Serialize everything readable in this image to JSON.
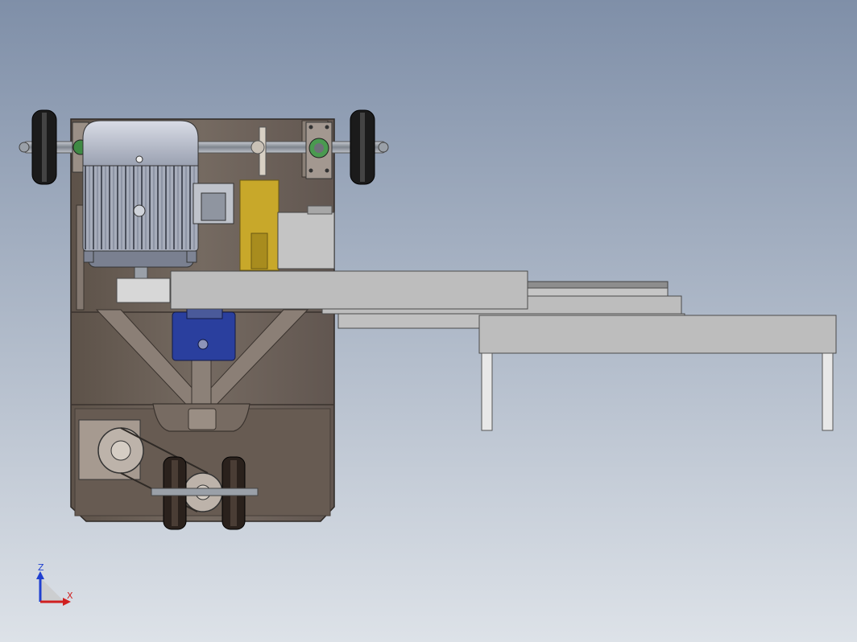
{
  "view": {
    "background_top": "#7f8fa8",
    "background_bottom": "#dde2e8"
  },
  "colors": {
    "frame": "#6e6258",
    "frame_dark": "#3f3833",
    "frame_light": "#9d928a",
    "motor_body": "#b6bcc9",
    "motor_fins": "#8f96a6",
    "motor_dark": "#4b505c",
    "gearbox_blue": "#2a3f9e",
    "yellow_plate": "#c8a82a",
    "conveyor": "#b9b9b9",
    "conveyor_edge": "#4a4a4a",
    "leg": "#e6e6e6",
    "wheel": "#1e1e1e",
    "axle": "#8a8f97",
    "axis_z": "#2040d0",
    "axis_x": "#d02020"
  },
  "triad": {
    "z_label": "Z",
    "x_label": "X"
  },
  "components": [
    "electric-motor",
    "drive-shaft",
    "bearing-block",
    "sprocket",
    "gearbox",
    "transfer-conveyor",
    "conveyor-leg",
    "rear-wheel",
    "front-caster",
    "chain-drive"
  ]
}
